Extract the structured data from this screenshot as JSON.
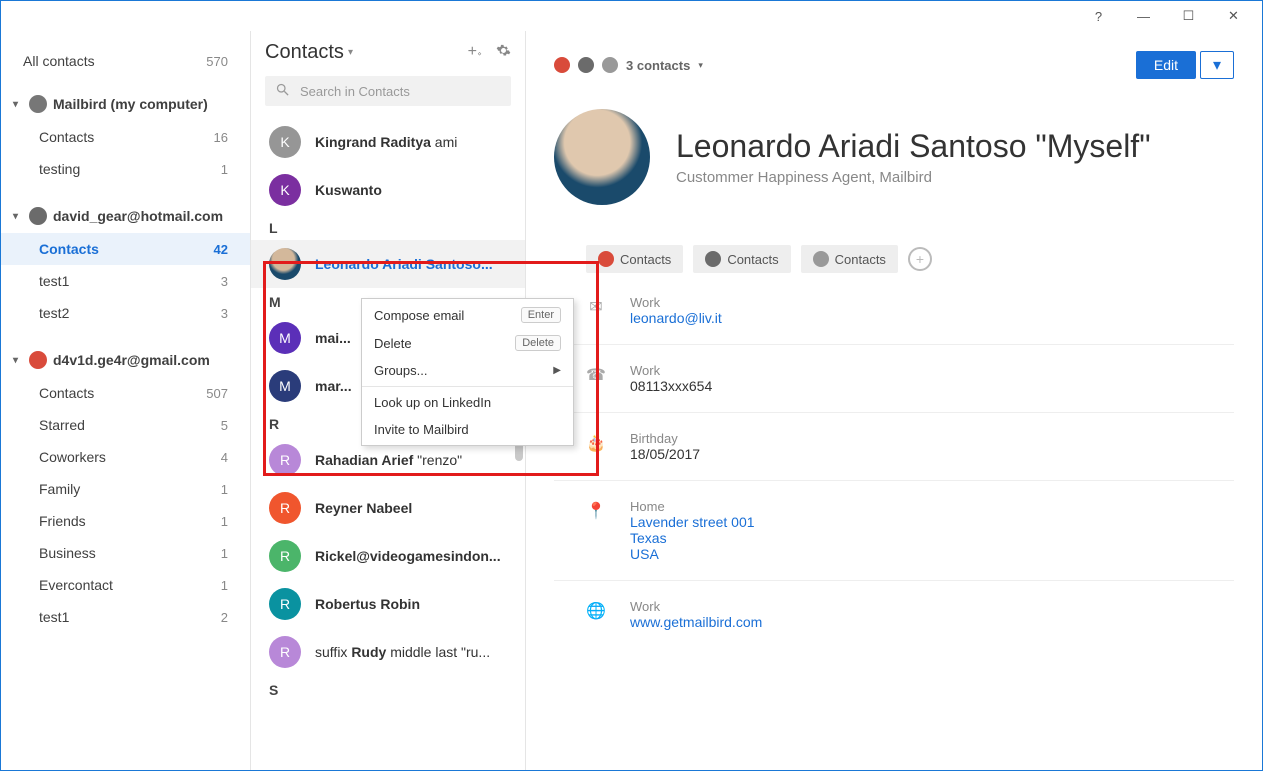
{
  "window": {
    "help": "?",
    "min": "—",
    "max": "☐",
    "close": "✕"
  },
  "sidebar": {
    "all_label": "All contacts",
    "all_count": "570",
    "accounts": [
      {
        "label": "Mailbird (my computer)",
        "icon_bg": "#777",
        "items": [
          {
            "label": "Contacts",
            "count": "16"
          },
          {
            "label": "testing",
            "count": "1"
          }
        ]
      },
      {
        "label": "david_gear@hotmail.com",
        "icon_bg": "#6b6b6b",
        "items": [
          {
            "label": "Contacts",
            "count": "42",
            "selected": true
          },
          {
            "label": "test1",
            "count": "3"
          },
          {
            "label": "test2",
            "count": "3"
          }
        ]
      },
      {
        "label": "d4v1d.ge4r@gmail.com",
        "icon_bg": "#d94b3b",
        "items": [
          {
            "label": "Contacts",
            "count": "507"
          },
          {
            "label": "Starred",
            "count": "5"
          },
          {
            "label": "Coworkers",
            "count": "4"
          },
          {
            "label": "Family",
            "count": "1"
          },
          {
            "label": "Friends",
            "count": "1"
          },
          {
            "label": "Business",
            "count": "1"
          },
          {
            "label": "Evercontact",
            "count": "1"
          },
          {
            "label": "test1",
            "count": "2"
          }
        ]
      }
    ]
  },
  "contacts_header": {
    "title": "Contacts",
    "search_placeholder": "Search in Contacts"
  },
  "contacts_list": [
    {
      "type": "row",
      "avatar": "K",
      "color": "#969696",
      "name_prefix": "",
      "name_bold": "Kingrand Raditya",
      "name_suffix": " ami"
    },
    {
      "type": "row",
      "avatar": "K",
      "color": "#7b2fa0",
      "name_bold": "Kuswanto"
    },
    {
      "type": "section",
      "letter": "L"
    },
    {
      "type": "row",
      "avatar_photo": true,
      "name_bold": "Leonardo Ariadi Santoso...",
      "selected": true
    },
    {
      "type": "section",
      "letter": "M"
    },
    {
      "type": "row",
      "avatar": "M",
      "color": "#5b2fb8",
      "name_bold": "mai..."
    },
    {
      "type": "row",
      "avatar": "M",
      "color": "#2a3c7a",
      "name_bold": "mar..."
    },
    {
      "type": "section",
      "letter": "R"
    },
    {
      "type": "row",
      "avatar": "R",
      "color": "#b888d8",
      "name_bold": "Rahadian Arief",
      "name_suffix": " \"renzo\""
    },
    {
      "type": "row",
      "avatar": "R",
      "color": "#f0562e",
      "name_bold": "Reyner Nabeel"
    },
    {
      "type": "row",
      "avatar": "R",
      "color": "#4bb56a",
      "name_bold": "Rickel@videogamesindon..."
    },
    {
      "type": "row",
      "avatar": "R",
      "color": "#0a92a0",
      "name_bold": "Robertus Robin"
    },
    {
      "type": "row",
      "avatar": "R",
      "color": "#b888d8",
      "name_prefix": "suffix ",
      "name_bold": "Rudy",
      "name_suffix": " middle last \"ru..."
    },
    {
      "type": "section",
      "letter": "S"
    }
  ],
  "context_menu": {
    "items": [
      {
        "label": "Compose email",
        "shortcut": "Enter"
      },
      {
        "label": "Delete",
        "shortcut": "Delete"
      },
      {
        "label": "Groups...",
        "submenu": true
      },
      {
        "sep": true
      },
      {
        "label": "Look up on LinkedIn"
      },
      {
        "label": "Invite to Mailbird"
      }
    ]
  },
  "detail": {
    "sources_count": "3 contacts",
    "edit": "Edit",
    "name": "Leonardo Ariadi Santoso \"Myself\"",
    "role": "Custommer Happiness Agent, Mailbird",
    "chips": [
      "Contacts",
      "Contacts",
      "Contacts"
    ],
    "email": {
      "label": "Work",
      "value": "leonardo@liv.it"
    },
    "phone": {
      "label": "Work",
      "value": "08113xxx654"
    },
    "birthday": {
      "label": "Birthday",
      "value": "18/05/2017"
    },
    "address": {
      "label": "Home",
      "lines": [
        "Lavender street 001",
        "Texas",
        "USA"
      ]
    },
    "web": {
      "label": "Work",
      "value": "www.getmailbird.com"
    }
  }
}
